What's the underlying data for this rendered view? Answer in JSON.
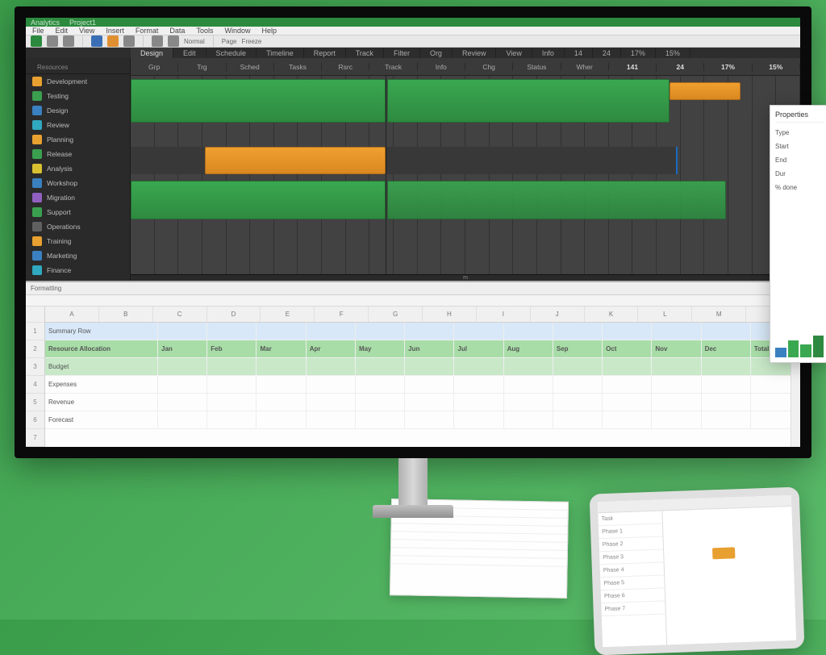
{
  "titlebar": {
    "app": "Analytics",
    "file": "Project1"
  },
  "menu": {
    "items": [
      "File",
      "Edit",
      "View",
      "Insert",
      "Format",
      "Data",
      "Tools",
      "Window",
      "Help"
    ]
  },
  "ribbon": {
    "labels": [
      "Normal",
      "Page",
      "Freeze"
    ]
  },
  "ctx_tabs": [
    "Design",
    "Edit",
    "Schedule",
    "Timeline",
    "Report",
    "Track",
    "Filter",
    "Org",
    "Review",
    "View",
    "Info",
    "14",
    "24",
    "17%",
    "15%"
  ],
  "ctx_active": 0,
  "sidebar": {
    "header": "Resources",
    "items": [
      {
        "color": "or",
        "label": "Development"
      },
      {
        "color": "gr",
        "label": "Testing"
      },
      {
        "color": "bl",
        "label": "Design"
      },
      {
        "color": "cy",
        "label": "Review"
      },
      {
        "color": "or",
        "label": "Planning"
      },
      {
        "color": "gr",
        "label": "Release"
      },
      {
        "color": "ye",
        "label": "Analysis"
      },
      {
        "color": "bl",
        "label": "Workshop"
      },
      {
        "color": "pu",
        "label": "Migration"
      },
      {
        "color": "gr",
        "label": "Support"
      },
      {
        "color": "dgr",
        "label": "Operations"
      },
      {
        "color": "or",
        "label": "Training"
      },
      {
        "color": "bl",
        "label": "Marketing"
      },
      {
        "color": "cy",
        "label": "Finance"
      }
    ]
  },
  "gantt": {
    "columns": [
      "Grp",
      "Trg",
      "Sched",
      "Tasks",
      "Rsrc",
      "Track",
      "Info",
      "Chg",
      "Status",
      "Wher",
      "141",
      "24",
      "17%",
      "15%"
    ],
    "ruler_label": "m"
  },
  "sheet": {
    "toolbar": "Formatting",
    "row_numbers": [
      "1",
      "2",
      "3",
      "4",
      "5",
      "6",
      "7"
    ],
    "col_heads": [
      "A",
      "B",
      "C",
      "D",
      "E",
      "F",
      "G",
      "H",
      "I",
      "J",
      "K",
      "L",
      "M",
      "N"
    ],
    "rows": [
      {
        "cls": "sel",
        "cells": [
          "Summary Row",
          "",
          "",
          "",
          "",
          "",
          "",
          "",
          "",
          "",
          "",
          "",
          "",
          ""
        ]
      },
      {
        "cls": "hdr",
        "cells": [
          "Resource Allocation",
          "Jan",
          "Feb",
          "Mar",
          "Apr",
          "May",
          "Jun",
          "Jul",
          "Aug",
          "Sep",
          "Oct",
          "Nov",
          "Dec",
          "Total"
        ]
      },
      {
        "cls": "hdr2",
        "cells": [
          "Budget",
          "",
          "",
          "",
          "",
          "",
          "",
          "",
          "",
          "",
          "",
          "",
          "",
          ""
        ]
      },
      {
        "cls": "",
        "cells": [
          "Expenses",
          "",
          "",
          "",
          "",
          "",
          "",
          "",
          "",
          "",
          "",
          "",
          "",
          ""
        ]
      },
      {
        "cls": "",
        "cells": [
          "Revenue",
          "",
          "",
          "",
          "",
          "",
          "",
          "",
          "",
          "",
          "",
          "",
          "",
          ""
        ]
      },
      {
        "cls": "",
        "cells": [
          "Forecast",
          "",
          "",
          "",
          "",
          "",
          "",
          "",
          "",
          "",
          "",
          "",
          "",
          ""
        ]
      }
    ]
  },
  "floatpanel": {
    "title": "Properties",
    "lines": [
      "Type",
      "Start",
      "End",
      "Dur",
      "% done"
    ]
  },
  "tablet": {
    "rows": [
      "Task",
      "Phase 1",
      "Phase 2",
      "Phase 3",
      "Phase 4",
      "Phase 5",
      "Phase 6",
      "Phase 7"
    ]
  },
  "colors": {
    "green": "#3aa850",
    "orange": "#e8a030",
    "blue": "#3a80c0"
  }
}
